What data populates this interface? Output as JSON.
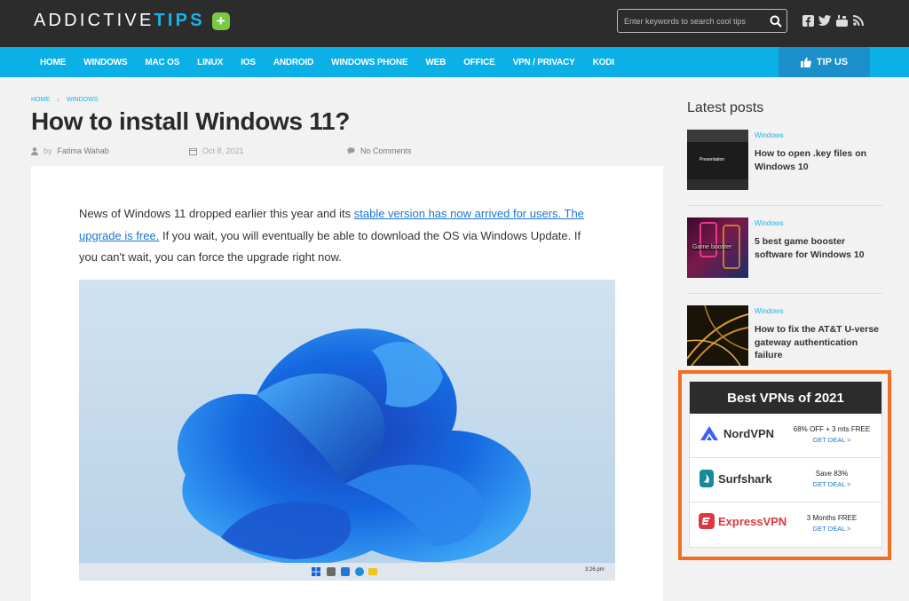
{
  "header": {
    "logo_part1": "ADDICTIVE",
    "logo_part2": "TIPS",
    "logo_plus": "+",
    "search_placeholder": "Enter keywords to search cool tips",
    "social_icons": [
      "facebook-icon",
      "twitter-icon",
      "youtube-icon",
      "rss-icon"
    ]
  },
  "nav": {
    "items": [
      "HOME",
      "WINDOWS",
      "MAC OS",
      "LINUX",
      "IOS",
      "ANDROID",
      "WINDOWS PHONE",
      "WEB",
      "OFFICE",
      "VPN / PRIVACY",
      "KODI"
    ],
    "tip_us": "TIP US"
  },
  "breadcrumb": {
    "home": "HOME",
    "section": "WINDOWS"
  },
  "article": {
    "title": "How to install Windows 11?",
    "author_prefix": "by",
    "author": "Fatima Wahab",
    "date": "Oct 8, 2021",
    "comments": "No Comments",
    "intro_before": "News of Windows 11 dropped earlier this year and its ",
    "intro_link": "stable version has now arrived for users. The upgrade is free.",
    "intro_after": " If you wait, you will eventually be able to download the OS via Windows Update. If you can't wait, you can force the upgrade right now."
  },
  "sidebar": {
    "heading": "Latest posts",
    "posts": [
      {
        "category": "Windows",
        "title": "How to open .key files on Windows 10",
        "thumb_label": "Presentation"
      },
      {
        "category": "Windows",
        "title": "5 best game booster software for Windows 10",
        "thumb_label": "Game booster"
      },
      {
        "category": "Windows",
        "title": "How to fix the AT&T U-verse gateway authentication failure",
        "thumb_label": ""
      }
    ]
  },
  "vpn": {
    "heading": "Best VPNs of 2021",
    "rows": [
      {
        "name": "NordVPN",
        "offer": "68% OFF + 3 mts FREE",
        "deal": "GET DEAL >"
      },
      {
        "name": "Surfshark",
        "offer": "Save 83%",
        "deal": "GET DEAL >"
      },
      {
        "name": "ExpressVPN",
        "offer": "3 Months FREE",
        "deal": "GET DEAL >"
      }
    ]
  },
  "colors": {
    "accent": "#0ab0e6",
    "header_bg": "#2c2c2c",
    "highlight": "#f26f21",
    "link": "#1b75d0"
  },
  "taskbar_time": "3:26 pm"
}
